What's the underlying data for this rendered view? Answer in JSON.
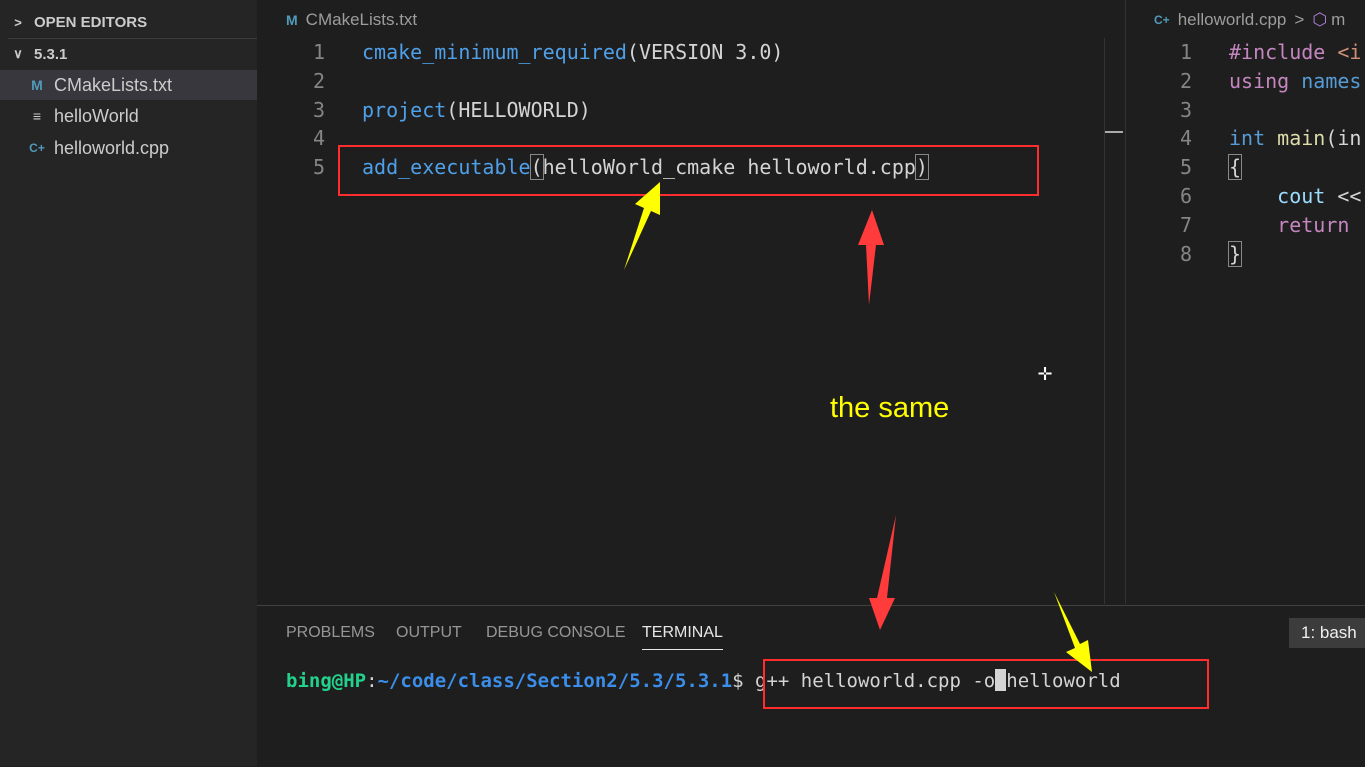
{
  "sidebar": {
    "open_editors_label": "OPEN EDITORS",
    "folder_label": "5.3.1",
    "files": [
      {
        "icon": "cmake-file-icon",
        "glyph": "M",
        "name": "CMakeLists.txt"
      },
      {
        "icon": "plain-file-icon",
        "glyph": "≡",
        "name": "helloWorld"
      },
      {
        "icon": "cpp-file-icon",
        "glyph": "C+",
        "name": "helloworld.cpp"
      }
    ]
  },
  "editor_left": {
    "tab_icon": "M",
    "tab_label": "CMakeLists.txt",
    "line_numbers": [
      "1",
      "2",
      "3",
      "4",
      "5"
    ],
    "line1": {
      "fn": "cmake_minimum_required",
      "rest": "(VERSION 3.0)"
    },
    "line3": {
      "fn": "project",
      "rest": "(HELLOWORLD)"
    },
    "line5": {
      "fn": "add_executable",
      "open": "(",
      "args": "helloWorld_cmake helloworld.cpp",
      "close": ")"
    }
  },
  "editor_right": {
    "tab_icon": "C+",
    "tab_label": "helloworld.cpp",
    "breadcrumb_sep": ">",
    "breadcrumb_partial": "m",
    "line_numbers": [
      "1",
      "2",
      "3",
      "4",
      "5",
      "6",
      "7",
      "8"
    ],
    "lines": {
      "l1a": "#include ",
      "l1b": "<i",
      "l2a": "using ",
      "l2b": "names",
      "l4a": "int ",
      "l4b": "main",
      "l4c": "(in",
      "l5": "{",
      "l6a": "    cout ",
      "l6b": "<<",
      "l7": "    return",
      "l8": "}"
    }
  },
  "panel": {
    "tabs": [
      "PROBLEMS",
      "OUTPUT",
      "DEBUG CONSOLE",
      "TERMINAL"
    ],
    "active_tab": "TERMINAL",
    "shell_selector": "1: bash",
    "terminal": {
      "user_host": "bing@HP",
      "colon": ":",
      "path": "~/code/class/Section2/5.3/5.3.1",
      "prompt": "$ ",
      "cmd_before_cursor": "g++ helloworld.cpp -o",
      "cmd_after_cursor": "helloworld"
    }
  },
  "annotation": {
    "text": "the same",
    "colors": {
      "box": "#ff2d2d",
      "red_arrow": "#ff3b3b",
      "yellow_arrow": "#ffff00",
      "text": "#ffff00"
    }
  }
}
